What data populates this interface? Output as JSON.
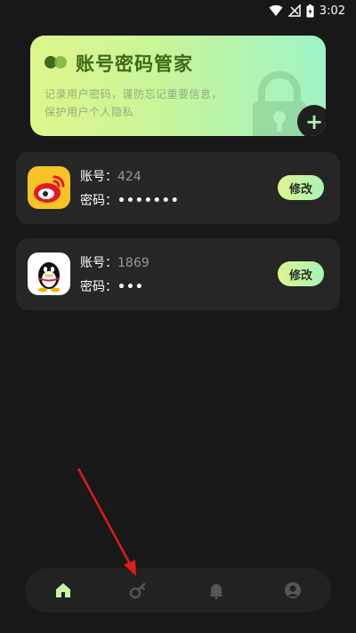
{
  "status_bar": {
    "time": "3:02"
  },
  "hero": {
    "title": "账号密码管家",
    "description": "记录用户密码，谨防忘记重要信息，保护用户个人隐私",
    "add_button_label": "+"
  },
  "labels": {
    "account": "账号：",
    "password": "密码：",
    "edit": "修改"
  },
  "accounts": [
    {
      "app_icon": "weibo-icon",
      "account": "424",
      "password": "•••••••"
    },
    {
      "app_icon": "qq-icon",
      "account": "1869",
      "password": "•••"
    }
  ],
  "bottom_nav": {
    "items": [
      {
        "icon": "home-icon",
        "active": true
      },
      {
        "icon": "key-icon",
        "active": false
      },
      {
        "icon": "bell-icon",
        "active": false
      },
      {
        "icon": "user-icon",
        "active": false
      }
    ]
  },
  "colors": {
    "background": "#181818",
    "card": "#262626",
    "accent_start": "#dff58c",
    "accent_end": "#9ef3c6",
    "annotation_arrow": "#e01b1b"
  }
}
